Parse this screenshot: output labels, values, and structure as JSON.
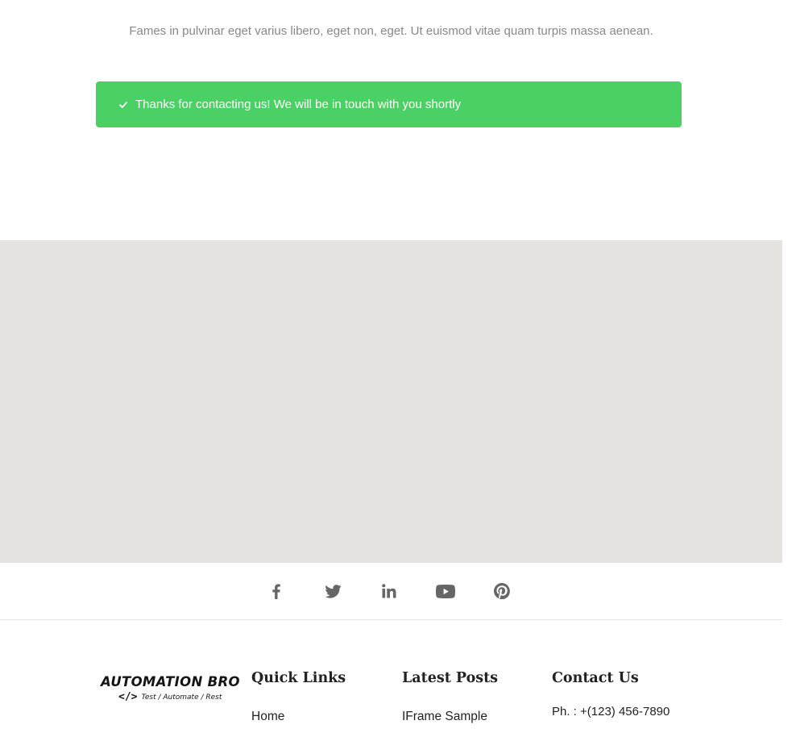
{
  "intro": {
    "text": "Fames in pulvinar eget varius libero, eget non, eget. Ut euismod vitae quam turpis massa aenean."
  },
  "success": {
    "message": "Thanks for contacting us! We will be in touch with you shortly",
    "color": "#4bd065",
    "icon": "check-icon"
  },
  "map": {
    "background": "#e5e3df"
  },
  "social": {
    "icons": [
      "facebook-icon",
      "twitter-icon",
      "linkedin-icon",
      "youtube-icon",
      "pinterest-icon"
    ]
  },
  "footer": {
    "logo": {
      "title": "AUTOMATION BRO",
      "code": "</>",
      "tagline": "Test / Automate / Rest"
    },
    "quick_links": {
      "heading": "Quick Links",
      "items": [
        "Home"
      ]
    },
    "latest_posts": {
      "heading": "Latest Posts",
      "items": [
        "IFrame Sample"
      ]
    },
    "contact": {
      "heading": "Contact Us",
      "phone": "Ph. : +(123) 456-7890"
    }
  }
}
